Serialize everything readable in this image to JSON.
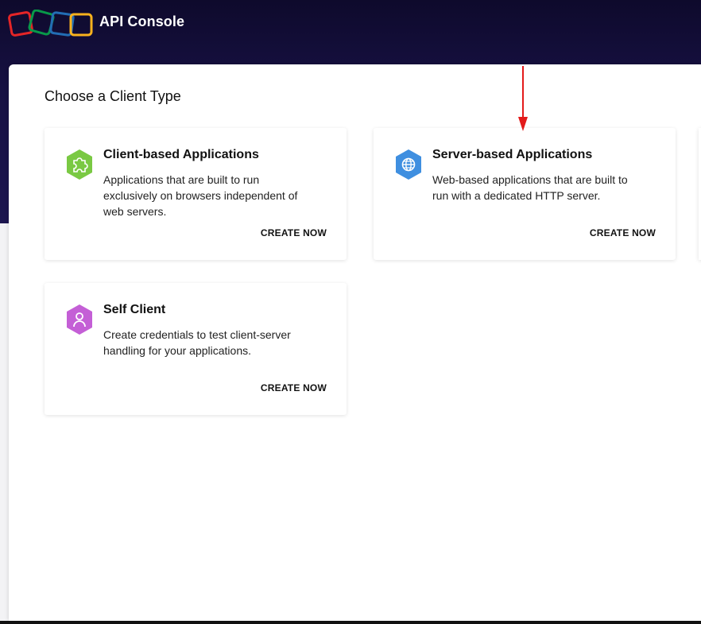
{
  "header": {
    "app_title": "API Console"
  },
  "main": {
    "section_title": "Choose a Client Type",
    "cards": [
      {
        "title": "Client-based Applications",
        "description": "Applications that are built to run exclusively on browsers independent of web servers.",
        "cta": "CREATE NOW",
        "icon": "puzzle-icon",
        "color": "#7ac943"
      },
      {
        "title": "Server-based Applications",
        "description": "Web-based applications that are built to run with a dedicated HTTP server.",
        "cta": "CREATE NOW",
        "icon": "globe-icon",
        "color": "#3f8fe0"
      },
      {
        "title": "Self Client",
        "description": "Create credentials to test client-server handling for your applications.",
        "cta": "CREATE NOW",
        "icon": "user-icon",
        "color": "#c45fd6"
      }
    ]
  },
  "annotation": {
    "arrow_color": "#e31b1b"
  }
}
